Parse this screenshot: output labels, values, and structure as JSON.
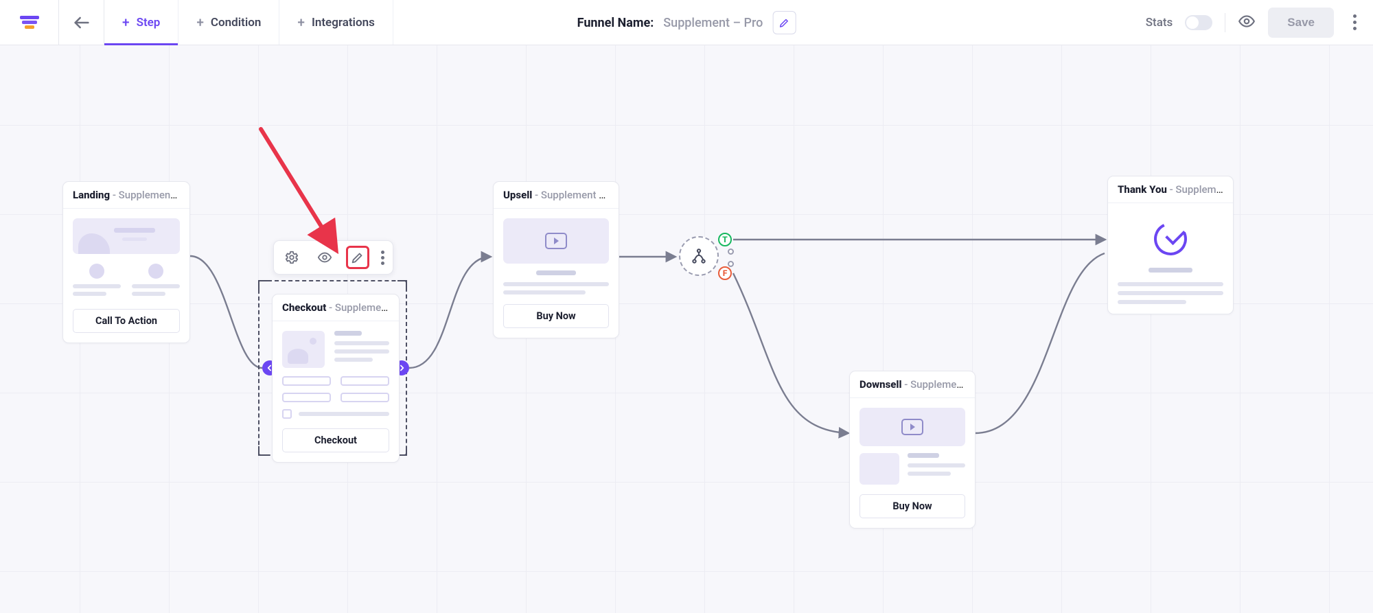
{
  "header": {
    "tabs": {
      "step": "Step",
      "condition": "Condition",
      "integrations": "Integrations"
    },
    "funnel_label": "Funnel Name:",
    "funnel_name": "Supplement – Pro",
    "stats_label": "Stats",
    "save_label": "Save"
  },
  "nodes": {
    "landing": {
      "title": "Landing",
      "sub": " - Supplement La…",
      "cta": "Call To Action"
    },
    "checkout": {
      "title": "Checkout",
      "sub": " - Supplement C…",
      "cta": "Checkout"
    },
    "upsell": {
      "title": "Upsell",
      "sub": " - Supplement U…",
      "cta": "Buy Now"
    },
    "downsell": {
      "title": "Downsell",
      "sub": " - Supplement D…",
      "cta": "Buy Now"
    },
    "thankyou": {
      "title": "Thank You",
      "sub": " - Supplement T…"
    }
  },
  "condition": {
    "true_label": "T",
    "false_label": "F"
  }
}
